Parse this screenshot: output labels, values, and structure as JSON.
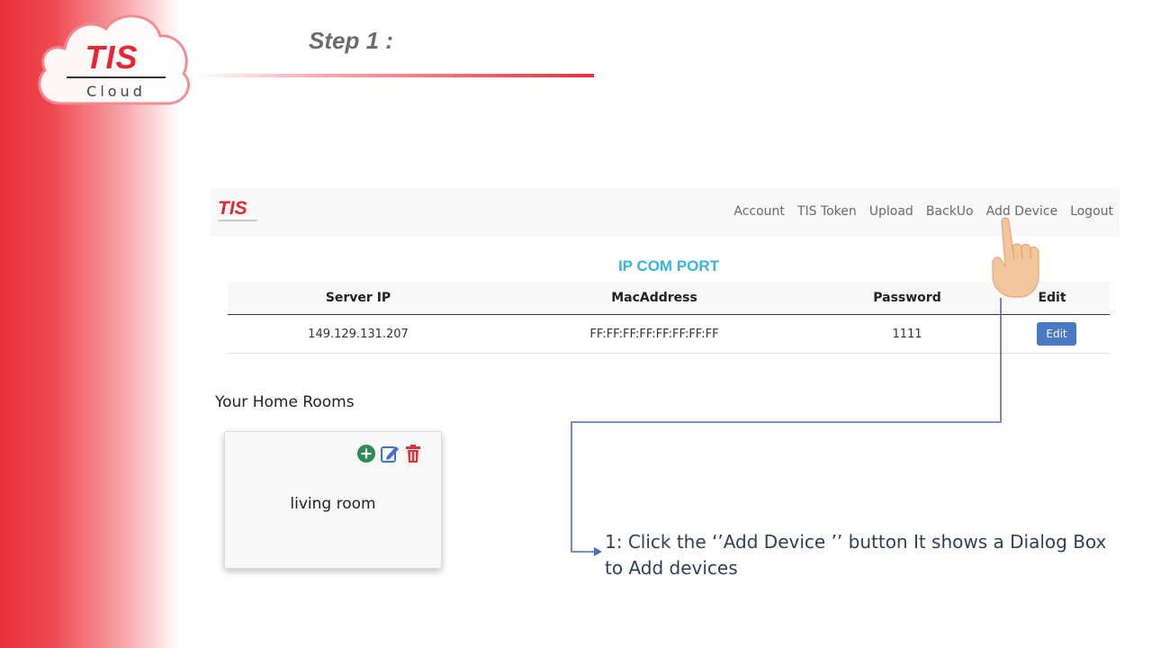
{
  "slide": {
    "logo_text": "TIS",
    "logo_sub": "Cloud",
    "step_title": "Step 1 :"
  },
  "app": {
    "brand": "TIS",
    "nav": [
      "Account",
      "TIS Token",
      "Upload",
      "BackUo",
      "Add Device",
      "Logout"
    ],
    "table_title": "IP COM PORT",
    "columns": [
      "Server IP",
      "MacAddress",
      "Password",
      "Edit"
    ],
    "row": {
      "server_ip": "149.129.131.207",
      "mac": "FF:FF:FF:FF:FF:FF:FF:FF",
      "password": "1111",
      "edit_label": "Edit"
    },
    "rooms_title": "Your Home Rooms",
    "room": {
      "name": "living room"
    }
  },
  "instruction": "1: Click the ‘’Add Device ’’ button It shows a Dialog Box to Add devices",
  "colors": {
    "brand_red": "#e8262f",
    "title_blue": "#3bb3e0",
    "button_blue": "#4a78c2",
    "add_green": "#2e8b57",
    "delete_red": "#d9343c",
    "connector": "#4a6fb3"
  },
  "icons": [
    "hand-pointer-icon",
    "plus-circle-icon",
    "edit-icon",
    "trash-icon"
  ]
}
